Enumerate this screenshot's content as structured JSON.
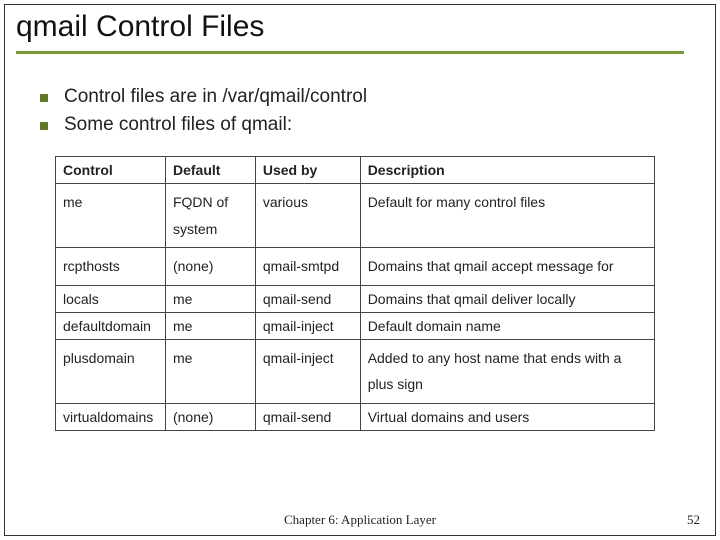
{
  "title": "qmail Control Files",
  "bullets": [
    "Control files are in /var/qmail/control",
    "Some control files of qmail:"
  ],
  "table": {
    "headers": [
      "Control",
      "Default",
      "Used by",
      "Description"
    ],
    "rows": [
      {
        "control": "me",
        "default": "FQDN of system",
        "usedby": "various",
        "desc": "Default for many control files"
      },
      {
        "control": "rcpthosts",
        "default": "(none)",
        "usedby": "qmail-smtpd",
        "desc": "Domains that qmail accept message for"
      },
      {
        "control": "locals",
        "default": "me",
        "usedby": "qmail-send",
        "desc": "Domains that qmail deliver locally"
      },
      {
        "control": "defaultdomain",
        "default": "me",
        "usedby": "qmail-inject",
        "desc": "Default domain name"
      },
      {
        "control": "plusdomain",
        "default": "me",
        "usedby": "qmail-inject",
        "desc": "Added to any host name that ends with a plus sign"
      },
      {
        "control": "virtualdomains",
        "default": "(none)",
        "usedby": "qmail-send",
        "desc": "Virtual domains and users"
      }
    ]
  },
  "footer": {
    "center": "Chapter 6: Application Layer",
    "page": "52"
  }
}
